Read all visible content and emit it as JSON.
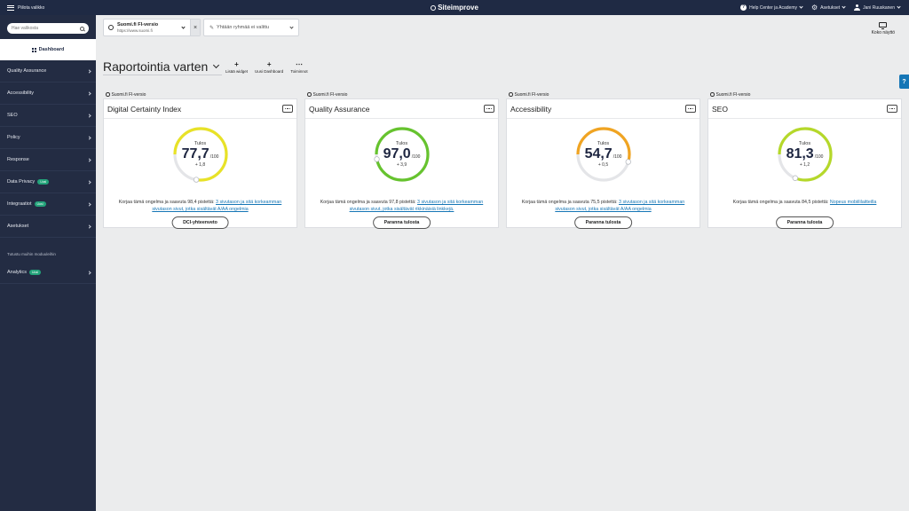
{
  "topbar": {
    "hide_menu": "Piilota valikko",
    "brand": "Siteimprove",
    "help": "Help Center ja Academy",
    "settings": "Asetukset",
    "user": "Jani Ruuskanen"
  },
  "sidebar": {
    "search_placeholder": "Hae valikosta",
    "dashboard": "Dashboard",
    "items": [
      {
        "label": "Quality Assurance"
      },
      {
        "label": "Accessibility"
      },
      {
        "label": "SEO"
      },
      {
        "label": "Policy"
      },
      {
        "label": "Response"
      },
      {
        "label": "Data Privacy",
        "badge": "Uusi"
      },
      {
        "label": "Integraatiot",
        "badge": "Uusi"
      },
      {
        "label": "Asetukset"
      }
    ],
    "section": "Tutustu muihin moduuleihin",
    "extra_items": [
      {
        "label": "Analytics",
        "badge": "Uusi"
      }
    ]
  },
  "toolbar": {
    "site_name": "Suomi.fi FI-versio",
    "site_url": "https://www.suomi.fi",
    "clear": "×",
    "group": "Yhtään ryhmää ei valittu",
    "fullscreen": "Koko näyttö"
  },
  "page": {
    "title": "Raportointia varten",
    "actions": [
      {
        "icon": "+",
        "label": "Lisää widget"
      },
      {
        "icon": "+",
        "label": "Uusi Dashboard"
      },
      {
        "icon": "⋯",
        "label": "Toiminnot"
      }
    ]
  },
  "help_tab": "?",
  "widgets": [
    {
      "site": "Suomi.fi FI-versio",
      "title": "Digital Certainty Index",
      "label": "Tulos",
      "score": "77,7",
      "score_value": 77.7,
      "max": "/100",
      "change": "+ 1,8",
      "color": "#e8e227",
      "desc_prefix": "Korjaa tämä ongelma ja saavuta 98,4 pistettä:",
      "desc_link": "3 sivutason ja sitä korkeamman sivutason sivut, jotka sisältävät A/AA ongelmia",
      "button": "DCI-yhteenveto"
    },
    {
      "site": "Suomi.fi FI-versio",
      "title": "Quality Assurance",
      "label": "Tulos",
      "score": "97,0",
      "score_value": 97.0,
      "max": "/100",
      "change": "+ 3,9",
      "color": "#66c32e",
      "desc_prefix": "Korjaa tämä ongelma ja saavuta 97,8 pistettä:",
      "desc_link": "3 sivutason ja sitä korkeamman sivutason sivut, jotka sisältävät rikkinäisiä linkkejä.",
      "button": "Paranna tulosta"
    },
    {
      "site": "Suomi.fi FI-versio",
      "title": "Accessibility",
      "label": "Tulos",
      "score": "54,7",
      "score_value": 54.7,
      "max": "/100",
      "change": "+ 0,5",
      "color": "#f0a422",
      "desc_prefix": "Korjaa tämä ongelma ja saavuta 75,5 pistettä:",
      "desc_link": "3 sivutason ja sitä korkeamman sivutason sivut, jotka sisältävät A/AA ongelmia",
      "button": "Paranna tulosta"
    },
    {
      "site": "Suomi.fi FI-versio",
      "title": "SEO",
      "label": "Tulos",
      "score": "81,3",
      "score_value": 81.3,
      "max": "/100",
      "change": "+ 1,2",
      "color": "#b5d82a",
      "desc_prefix": "Korjaa tämä ongelma ja saavuta 84,5 pistettä:",
      "desc_link": "Nopeus mobiililaitteilla",
      "button": "Paranna tulosta"
    }
  ]
}
